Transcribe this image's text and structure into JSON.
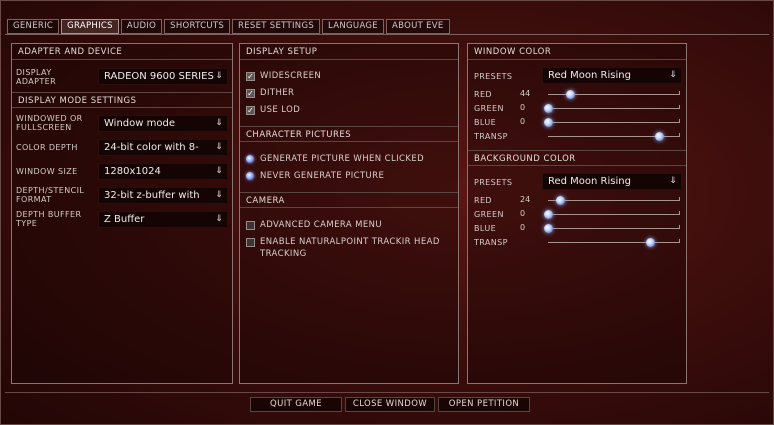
{
  "tabs": [
    "GENERIC",
    "GRAPHICS",
    "AUDIO",
    "SHORTCUTS",
    "RESET SETTINGS",
    "LANGUAGE",
    "ABOUT EVE"
  ],
  "active_tab": "GRAPHICS",
  "adapter": {
    "header": "ADAPTER AND DEVICE",
    "display_adapter_label": "DISPLAY ADAPTER",
    "display_adapter_value": "RADEON 9600 SERIES"
  },
  "display_mode": {
    "header": "DISPLAY MODE SETTINGS",
    "windowed_label": "WINDOWED OR FULLSCREEN",
    "windowed_value": "Window mode",
    "color_depth_label": "COLOR DEPTH",
    "color_depth_value": "24-bit color with 8-",
    "window_size_label": "WINDOW SIZE",
    "window_size_value": "1280x1024",
    "stencil_label": "DEPTH/STENCIL FORMAT",
    "stencil_value": "32-bit z-buffer with",
    "depth_buffer_label": "DEPTH BUFFER TYPE",
    "depth_buffer_value": "Z Buffer"
  },
  "display_setup": {
    "header": "DISPLAY SETUP",
    "options": [
      {
        "label": "WIDESCREEN",
        "checked": true
      },
      {
        "label": "DITHER",
        "checked": true
      },
      {
        "label": "USE LOD",
        "checked": true
      }
    ]
  },
  "character_pictures": {
    "header": "CHARACTER PICTURES",
    "options": [
      {
        "label": "GENERATE PICTURE WHEN CLICKED"
      },
      {
        "label": "NEVER GENERATE PICTURE"
      }
    ]
  },
  "camera": {
    "header": "CAMERA",
    "advanced_label": "ADVANCED CAMERA MENU",
    "trackir_label_1": "ENABLE NATURALPOINT TRACKIR HEAD",
    "trackir_label_2": "TRACKING"
  },
  "window_color": {
    "header": "WINDOW COLOR",
    "presets_label": "PRESETS",
    "presets_value": "Red Moon Rising",
    "sliders": [
      {
        "label": "RED",
        "value": "44",
        "position": 0.17
      },
      {
        "label": "GREEN",
        "value": "0",
        "position": 0.0
      },
      {
        "label": "BLUE",
        "value": "0",
        "position": 0.0
      },
      {
        "label": "TRANSP",
        "value": "",
        "position": 0.84
      }
    ]
  },
  "background_color": {
    "header": "BACKGROUND COLOR",
    "presets_label": "PRESETS",
    "presets_value": "Red Moon Rising",
    "sliders": [
      {
        "label": "RED",
        "value": "24",
        "position": 0.09
      },
      {
        "label": "GREEN",
        "value": "0",
        "position": 0.0
      },
      {
        "label": "BLUE",
        "value": "0",
        "position": 0.0
      },
      {
        "label": "TRANSP",
        "value": "",
        "position": 0.77
      }
    ]
  },
  "buttons": {
    "quit": "QUIT GAME",
    "close": "CLOSE WINDOW",
    "petition": "OPEN PETITION"
  },
  "icons": {
    "dropdown": "chevron-down-double-icon",
    "checkbox": "checkbox-checked-icon",
    "radio": "radio-icon"
  },
  "colors": {
    "background": "#3e0e0c",
    "accent": "#8cb0ff"
  }
}
